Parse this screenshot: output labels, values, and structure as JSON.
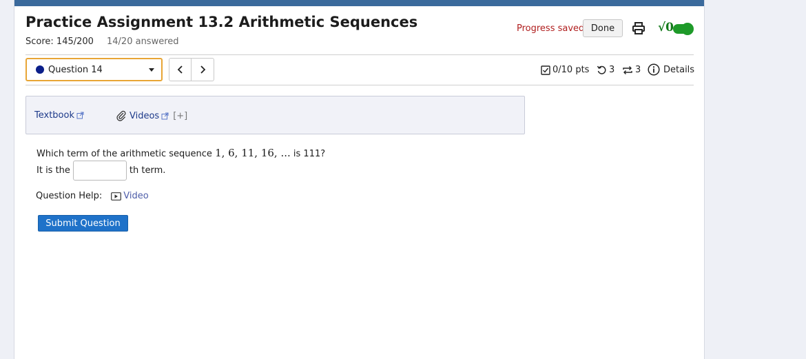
{
  "header": {
    "title": "Practice Assignment 13.2 Arithmetic Sequences",
    "score": "Score: 145/200",
    "answered": "14/20 answered",
    "progress_saved": "Progress saved",
    "done_label": "Done",
    "sqrt_label": "√0"
  },
  "question_nav": {
    "selected_question": "Question 14",
    "prev_glyph": "‹",
    "next_glyph": "›",
    "points": "0/10 pts",
    "retries": "3",
    "attempts": "3",
    "details": "Details"
  },
  "resources": {
    "textbook": "Textbook",
    "videos": "Videos",
    "expand": "[+]"
  },
  "question": {
    "prompt_prefix": "Which term of the arithmetic sequence ",
    "sequence": "1, 6, 11, 16, ...",
    "prompt_suffix": " is 111?",
    "answer_prefix": "It is the",
    "answer_value": "",
    "answer_suffix": "th term.",
    "help_label": "Question Help:",
    "help_video": "Video",
    "submit_label": "Submit Question"
  },
  "colors": {
    "topbar": "#3b6a9c",
    "progress_saved": "#b01e1e",
    "select_border": "#e8a535",
    "toggle": "#1e9a29",
    "submit": "#1f72c9",
    "link": "#1d3a8a"
  },
  "icons": [
    "print-icon",
    "sqrt-icon",
    "toggle-icon",
    "chevron-left-icon",
    "chevron-right-icon",
    "checkbox-icon",
    "retry-icon",
    "attempts-icon",
    "info-icon",
    "external-link-icon",
    "paperclip-icon",
    "video-icon"
  ]
}
